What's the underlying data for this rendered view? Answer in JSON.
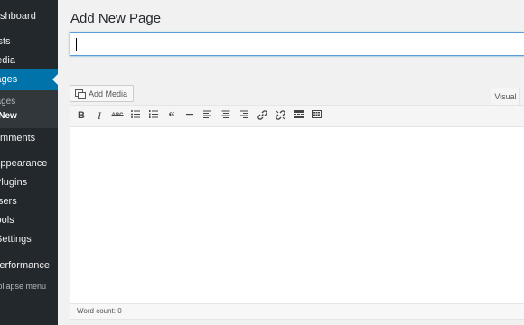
{
  "sidebar": {
    "items": [
      {
        "label": "Dashboard"
      },
      {
        "label": "Posts"
      },
      {
        "label": "Media"
      },
      {
        "label": "Pages"
      },
      {
        "label": "Comments"
      },
      {
        "label": "Appearance"
      },
      {
        "label": "Plugins"
      },
      {
        "label": "Users"
      },
      {
        "label": "Tools"
      },
      {
        "label": "Settings"
      },
      {
        "label": "Performance"
      },
      {
        "label": "Collapse menu"
      }
    ],
    "submenu": [
      {
        "label": "All Pages"
      },
      {
        "label": "Add New"
      }
    ]
  },
  "main": {
    "title": "Add New Page",
    "title_input_value": "",
    "add_media_label": "Add Media",
    "visual_tab_label": "Visual",
    "toolbar": {
      "bold": "B",
      "italic": "I",
      "strikethrough": "ABC",
      "quote": "“"
    },
    "word_count": "Word count: 0"
  },
  "colors": {
    "sidebar_bg": "#23282d",
    "active_menu": "#0073aa",
    "page_bg": "#f1f1f1"
  }
}
